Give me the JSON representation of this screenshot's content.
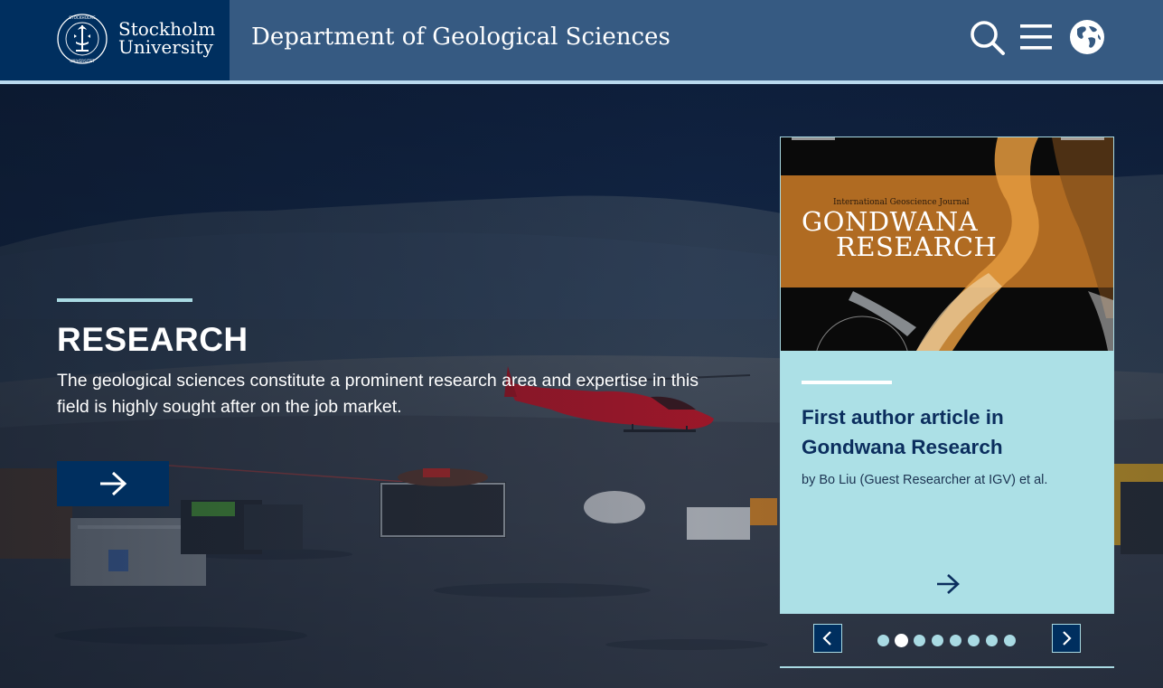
{
  "header": {
    "logo": {
      "line1": "Stockholm",
      "line2": "University",
      "seal_text": "STOCKHOLMS UNIVERSITET"
    },
    "department_title": "Department of Geological Sciences",
    "icons": [
      "search-icon",
      "menu-icon",
      "globe-icon"
    ]
  },
  "hero": {
    "image_alt": "Field camp with red helicopter, equipment boxes and hills under blue sky",
    "title": "RESEARCH",
    "description": "The geological sciences constitute a prominent research area and expertise in this field is highly sought after on the job market.",
    "button_icon": "arrow-right-icon"
  },
  "card": {
    "cover": {
      "small_label": "International Geoscience Journal",
      "title_line1": "GONDWANA",
      "title_line2": "RESEARCH",
      "alt": "Gondwana Research journal cover with orange and black abstract rock"
    },
    "headline": "First author article in Gondwana Research",
    "byline": "by Bo Liu (Guest Researcher at IGV) et al.",
    "arrow_icon": "arrow-right-icon"
  },
  "carousel": {
    "prev_icon": "chevron-left-icon",
    "next_icon": "chevron-right-icon",
    "slide_count": 8,
    "active_slide": 2
  },
  "colors": {
    "header_bg": "#365a82",
    "logo_bg": "#002f5f",
    "accent_light": "#a9dae3",
    "card_bg": "#ace0e6",
    "headline": "#0b2e5e"
  }
}
